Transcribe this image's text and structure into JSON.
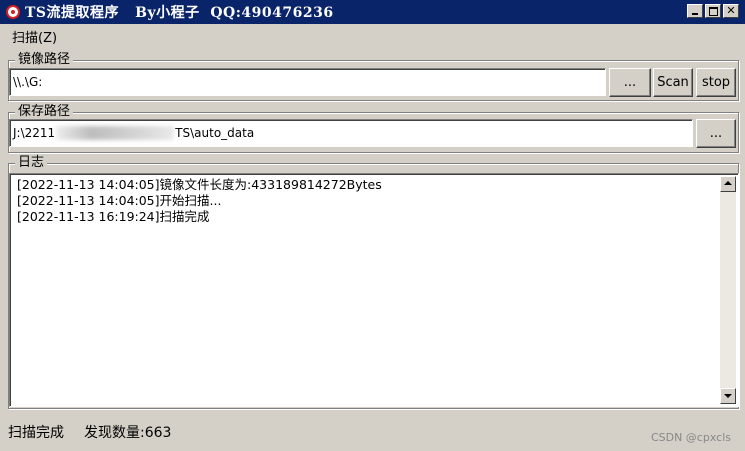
{
  "window": {
    "title": "TS流提取程序   By小程子  QQ:490476236",
    "buttons": [
      "minimize",
      "maximize",
      "close"
    ]
  },
  "menu": {
    "scan_label": "扫描(Z)"
  },
  "image_group": {
    "label": "镜像路径",
    "path_value": "\\\\.\\G:",
    "browse_label": "...",
    "scan_label": "Scan",
    "stop_label": "stop"
  },
  "save_group": {
    "label": "保存路径",
    "path_prefix": "J:\\2211",
    "path_suffix": "TS\\auto_data",
    "browse_label": "..."
  },
  "log_group": {
    "label": "日志",
    "lines": [
      "[2022-11-13 14:04:05]镜像文件长度为:433189814272Bytes",
      "[2022-11-13 14:04:05]开始扫描...",
      "[2022-11-13 16:19:24]扫描完成"
    ]
  },
  "status": {
    "state": "扫描完成",
    "found_count": "发现数量:663"
  },
  "watermark": "CSDN @cpxcls",
  "colors": {
    "titlebar": "#0a246a",
    "face": "#d4d0c8"
  }
}
